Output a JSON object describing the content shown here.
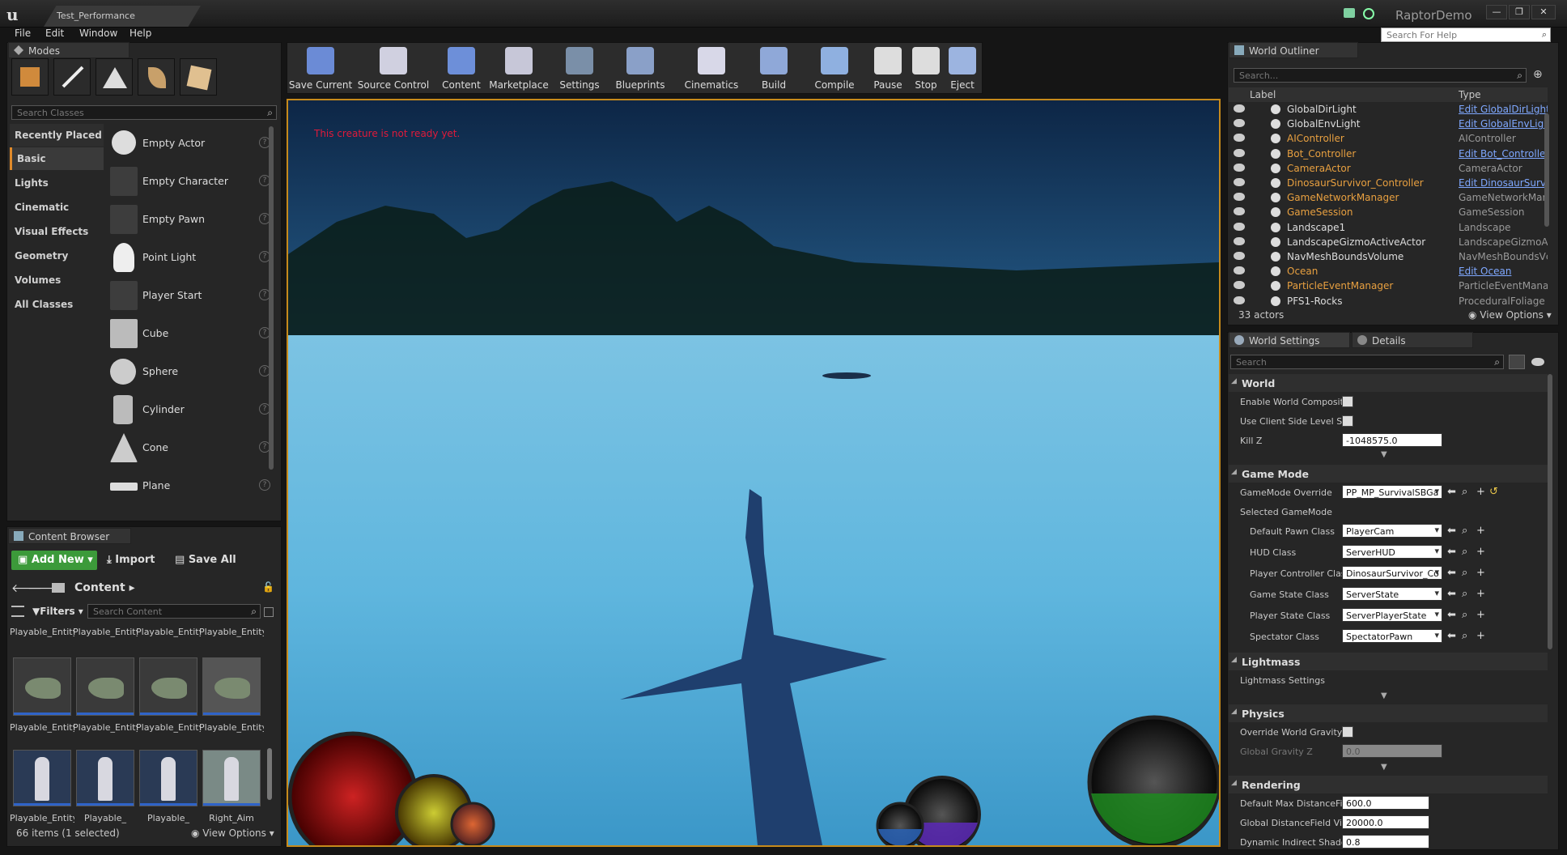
{
  "titlebar": {
    "tab_label": "Test_Performance",
    "app_name": "RaptorDemo",
    "help_search_placeholder": "Search For Help",
    "minimize": "—",
    "maximize": "❐",
    "close": "✕"
  },
  "menu": [
    "File",
    "Edit",
    "Window",
    "Help"
  ],
  "modes": {
    "tab_label": "Modes",
    "search_placeholder": "Search Classes",
    "categories": [
      "Recently Placed",
      "Basic",
      "Lights",
      "Cinematic",
      "Visual Effects",
      "Geometry",
      "Volumes",
      "All Classes"
    ],
    "items": [
      "Empty Actor",
      "Empty Character",
      "Empty Pawn",
      "Point Light",
      "Player Start",
      "Cube",
      "Sphere",
      "Cylinder",
      "Cone",
      "Plane"
    ]
  },
  "toolbar": {
    "buttons": [
      "Save Current",
      "Source Control",
      "Content",
      "Marketplace",
      "Settings",
      "Blueprints",
      "Cinematics",
      "Build",
      "Compile",
      "Pause",
      "Stop",
      "Eject"
    ]
  },
  "viewport": {
    "message": "This creature is not ready yet."
  },
  "outliner": {
    "tab_label": "World Outliner",
    "search_placeholder": "Search...",
    "col_label": "Label",
    "col_type": "Type",
    "rows": [
      {
        "label": "GlobalDirLight",
        "type": "Edit GlobalDirLight",
        "link": true
      },
      {
        "label": "GlobalEnvLight",
        "type": "Edit GlobalEnvLigh",
        "link": true
      },
      {
        "label": "AIController",
        "type": "AIController",
        "link": false
      },
      {
        "label": "Bot_Controller",
        "type": "Edit Bot_Controller",
        "link": true
      },
      {
        "label": "CameraActor",
        "type": "CameraActor",
        "link": false
      },
      {
        "label": "DinosaurSurvivor_Controller",
        "type": "Edit DinosaurSurv",
        "link": true
      },
      {
        "label": "GameNetworkManager",
        "type": "GameNetworkMana",
        "link": false
      },
      {
        "label": "GameSession",
        "type": "GameSession",
        "link": false
      },
      {
        "label": "Landscape1",
        "type": "Landscape",
        "link": false
      },
      {
        "label": "LandscapeGizmoActiveActor",
        "type": "LandscapeGizmoAc",
        "link": false
      },
      {
        "label": "NavMeshBoundsVolume",
        "type": "NavMeshBoundsVc",
        "link": false
      },
      {
        "label": "Ocean",
        "type": "Edit Ocean",
        "link": true
      },
      {
        "label": "ParticleEventManager",
        "type": "ParticleEventMana",
        "link": false
      },
      {
        "label": "PFS1-Rocks",
        "type": "ProceduralFoliage",
        "link": false
      }
    ],
    "count": "33 actors",
    "view_options": "View Options"
  },
  "details": {
    "tab_world": "World Settings",
    "tab_details": "Details",
    "search_placeholder": "Search",
    "world": {
      "section": "World",
      "enable_world_comp": "Enable World Compositi",
      "use_client_side": "Use Client Side Level St",
      "kill_z_label": "Kill Z",
      "kill_z_value": "-1048575.0"
    },
    "game_mode": {
      "section": "Game Mode",
      "override_label": "GameMode Override",
      "override_value": "PP_MP_SurvivalSBGa",
      "selected": "Selected GameMode",
      "rows": [
        {
          "label": "Default Pawn Class",
          "value": "PlayerCam"
        },
        {
          "label": "HUD Class",
          "value": "ServerHUD"
        },
        {
          "label": "Player Controller Clas",
          "value": "DinosaurSurvivor_Co"
        },
        {
          "label": "Game State Class",
          "value": "ServerState"
        },
        {
          "label": "Player State Class",
          "value": "ServerPlayerState"
        },
        {
          "label": "Spectator Class",
          "value": "SpectatorPawn"
        }
      ]
    },
    "lightmass": {
      "section": "Lightmass",
      "settings": "Lightmass Settings"
    },
    "physics": {
      "section": "Physics",
      "override_gravity": "Override World Gravity",
      "global_gravity_label": "Global Gravity Z",
      "global_gravity_value": "0.0"
    },
    "rendering": {
      "section": "Rendering",
      "rows": [
        {
          "label": "Default Max DistanceFi",
          "value": "600.0"
        },
        {
          "label": "Global DistanceField Vie",
          "value": "20000.0"
        },
        {
          "label": "Dynamic Indirect Shado",
          "value": "0.8"
        }
      ]
    }
  },
  "content_browser": {
    "tab_label": "Content Browser",
    "add_new": "Add New",
    "import": "Import",
    "save_all": "Save All",
    "path": "Content",
    "filters": "Filters",
    "search_placeholder": "Search Content",
    "top_labels": [
      "Playable_Entity_crocanthosaurus",
      "Playable_Entity_Apatosaurus",
      "Playable_Entity_Elasmosaurus",
      "Playable_Entity_Mosasaurus"
    ],
    "row1_labels": [
      "Playable_Entity_Para",
      "Playable_Entity_Pteranodon",
      "Playable_Entity_Utahraptor",
      "Playable_Entity_Velociraptor"
    ],
    "row2_labels": [
      "Playable_Entity",
      "Playable_",
      "Playable_",
      "Right_Aim"
    ],
    "count": "66 items (1 selected)",
    "view_options": "View Options"
  }
}
